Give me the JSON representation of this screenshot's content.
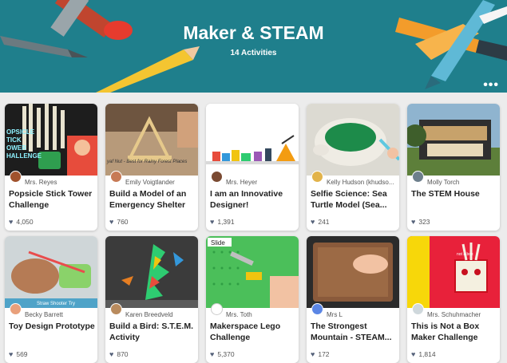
{
  "banner": {
    "title": "Maker & STEAM",
    "subtitle": "14 Activities",
    "more_label": "•••"
  },
  "colors": {
    "banner": "#1f7f8c",
    "card": "#ffffff",
    "heart": "#56627a"
  },
  "cards": [
    {
      "author": "Mrs. Reyes",
      "title": "Popsicle Stick Tower Challenge",
      "likes": "4,050",
      "avatar_color": "#a0522d",
      "thumb_text": "OPSICLE\nTICK\nTOWER\nHALLENGE"
    },
    {
      "author": "Emily Voigtlander",
      "title": "Build a Model of an Emergency Shelter",
      "likes": "760",
      "avatar_color": "#c77a55",
      "thumb_text": "yaf Nut - Best for Rainy Forest Places"
    },
    {
      "author": "Mrs. Heyer",
      "title": "I am an Innovative Designer!",
      "likes": "1,391",
      "avatar_color": "#7a4a32",
      "thumb_text": ""
    },
    {
      "author": "Kelly Hudson (khudso...",
      "title": "Selfie Science: Sea Turtle Model (Sea...",
      "likes": "241",
      "avatar_color": "#e2b34a",
      "thumb_text": ""
    },
    {
      "author": "Molly Torch",
      "title": "The STEM House",
      "likes": "323",
      "avatar_color": "#6d7f8c",
      "thumb_text": ""
    },
    {
      "author": "Becky Barrett",
      "title": "Toy Design Prototype",
      "likes": "569",
      "avatar_color": "#e9a07b",
      "thumb_text": "Straw Shooter Try"
    },
    {
      "author": "Karen Breedveld",
      "title": "Build a Bird: S.T.E.M. Activity",
      "likes": "870",
      "avatar_color": "#b98b5e",
      "thumb_text": ""
    },
    {
      "author": "Mrs. Toth",
      "title": "Makerspace Lego Challenge",
      "likes": "5,370",
      "avatar_color": "#ffffff",
      "thumb_text": "Slide"
    },
    {
      "author": "Mrs L",
      "title": "The Strongest Mountain - STEAM...",
      "likes": "172",
      "avatar_color": "#5b86e5",
      "thumb_text": ""
    },
    {
      "author": "Mrs. Schuhmacher",
      "title": "This is Not a Box Maker Challenge",
      "likes": "1,814",
      "avatar_color": "#cfd8dc",
      "thumb_text": "not a box"
    }
  ]
}
